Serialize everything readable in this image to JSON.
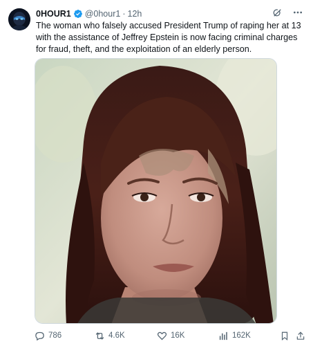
{
  "author": {
    "display_name": "0HOUR1",
    "handle": "@0hour1",
    "separator": "·",
    "time": "12h",
    "verified_icon": "verified-badge-icon",
    "avatar": "avatar-icon"
  },
  "tweet": {
    "text": "The woman who falsely accused President Trump of raping her at 13 with the assistance of Jeffrey Epstein is now facing criminal charges for fraud, theft, and the exploitation of an elderly person."
  },
  "header_actions": [
    {
      "icon": "grok-icon"
    },
    {
      "icon": "more-icon"
    }
  ],
  "actions": {
    "reply": {
      "icon": "reply-icon",
      "count": "786"
    },
    "repost": {
      "icon": "repost-icon",
      "count": "4.6K"
    },
    "like": {
      "icon": "heart-icon",
      "count": "16K"
    },
    "views": {
      "icon": "views-icon",
      "count": "162K"
    },
    "bookmark": {
      "icon": "bookmark-icon"
    },
    "share": {
      "icon": "share-icon"
    }
  },
  "colors": {
    "text": "#0f1419",
    "secondary": "#536471",
    "verified": "#1d9bf0",
    "border": "#cfd9de"
  }
}
